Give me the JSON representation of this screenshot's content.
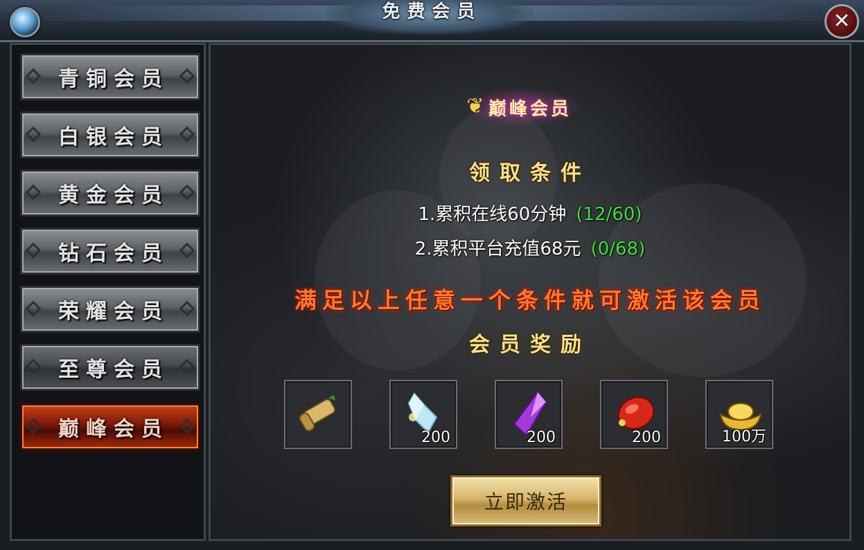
{
  "window": {
    "title": "免费会员"
  },
  "sidebar": {
    "tabs": [
      {
        "label": "青铜会员",
        "state": "normal"
      },
      {
        "label": "白银会员",
        "state": "normal"
      },
      {
        "label": "黄金会员",
        "state": "normal"
      },
      {
        "label": "钻石会员",
        "state": "normal"
      },
      {
        "label": "荣耀会员",
        "state": "normal"
      },
      {
        "label": "至尊会员",
        "state": "dim"
      },
      {
        "label": "巅峰会员",
        "state": "active"
      }
    ]
  },
  "main": {
    "badge": "巅峰会员",
    "conditions_heading": "领取条件",
    "conditions": [
      {
        "text": "1.累积在线60分钟",
        "progress": "(12/60)"
      },
      {
        "text": "2.累积平台充值68元",
        "progress": "(0/68)"
      }
    ],
    "notice": "满足以上任意一个条件就可激活该会员",
    "rewards_heading": "会员奖励",
    "rewards": [
      {
        "icon": "scroll-icon",
        "qty": ""
      },
      {
        "icon": "crystal-shard-icon",
        "qty": "200"
      },
      {
        "icon": "purple-gem-icon",
        "qty": "200"
      },
      {
        "icon": "red-gem-icon",
        "qty": "200"
      },
      {
        "icon": "gold-ingot-icon",
        "qty": "100万"
      }
    ],
    "activate_label": "立即激活"
  },
  "colors": {
    "progress": "#3fe03f",
    "notice": "#ff7a2a",
    "heading": "#ffe18a",
    "active_tab": "#c8421a"
  }
}
